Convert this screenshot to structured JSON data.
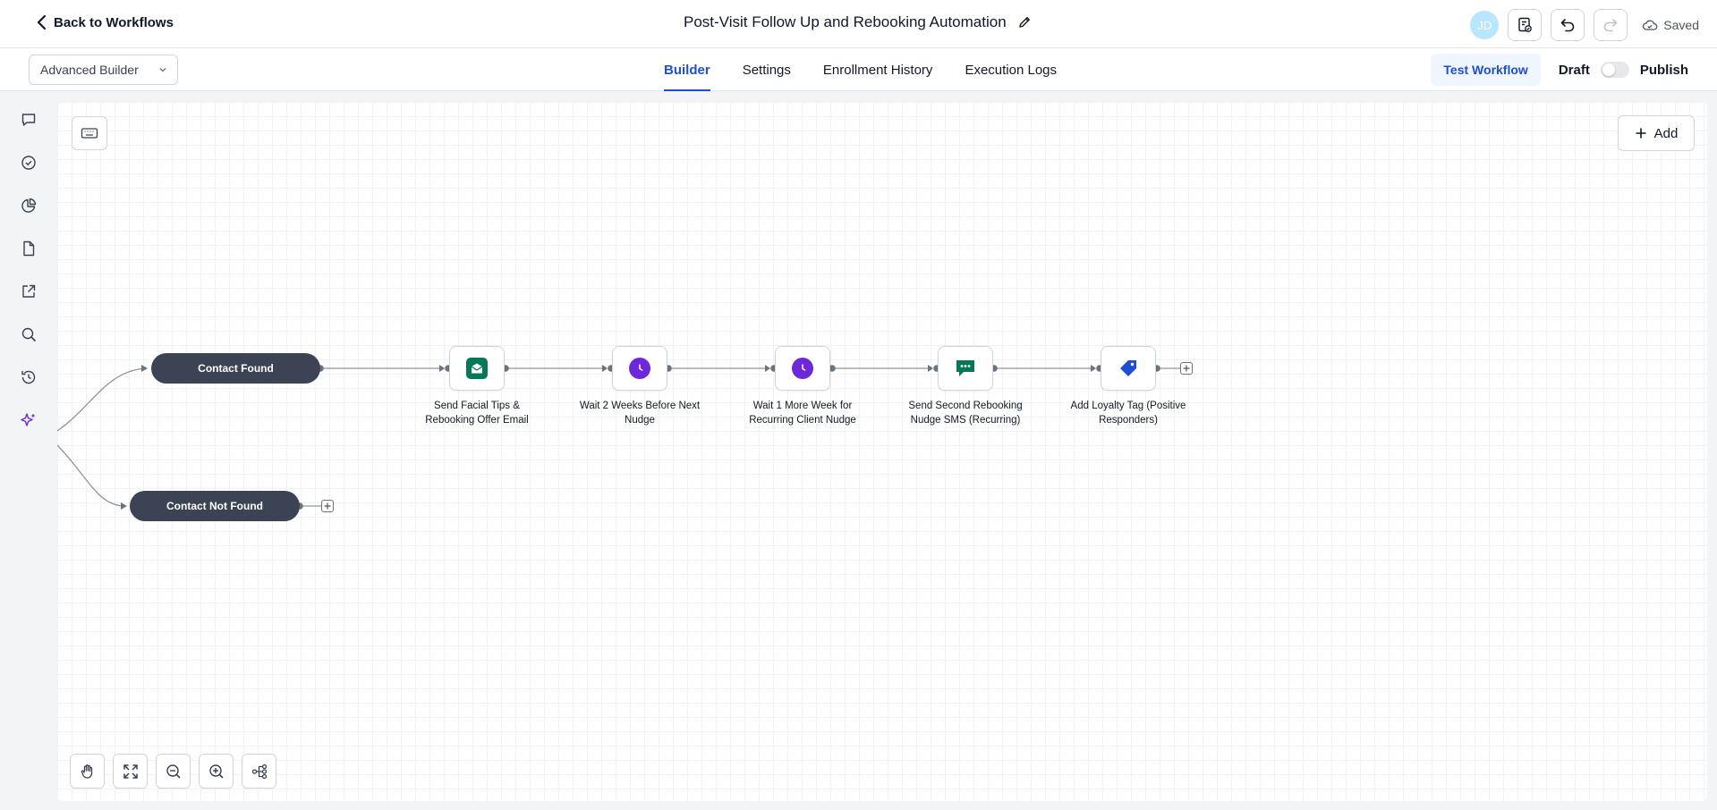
{
  "header": {
    "back_label": "Back to Workflows",
    "title": "Post-Visit Follow Up and Rebooking Automation",
    "avatar_initials": "JD",
    "saved_label": "Saved"
  },
  "subbar": {
    "builder_mode": "Advanced Builder",
    "tabs": [
      {
        "label": "Builder",
        "active": true
      },
      {
        "label": "Settings",
        "active": false
      },
      {
        "label": "Enrollment History",
        "active": false
      },
      {
        "label": "Execution Logs",
        "active": false
      }
    ],
    "test_label": "Test Workflow",
    "draft_label": "Draft",
    "publish_label": "Publish",
    "published": false
  },
  "sidebar": {
    "icons": [
      "chat-icon",
      "check-circle-icon",
      "pie-chart-icon",
      "file-icon",
      "external-link-icon",
      "search-icon",
      "history-icon",
      "sparkle-icon"
    ]
  },
  "canvas": {
    "add_label": "Add",
    "branches": [
      {
        "label": "Contact Found"
      },
      {
        "label": "Contact Not Found"
      }
    ],
    "steps": [
      {
        "label": "Send Facial Tips & Rebooking Offer Email",
        "icon": "email-icon",
        "color": "#047857"
      },
      {
        "label": "Wait 2 Weeks Before Next Nudge",
        "icon": "clock-icon",
        "color": "#6d28d9"
      },
      {
        "label": "Wait 1 More Week for Recurring Client Nudge",
        "icon": "clock-icon",
        "color": "#6d28d9"
      },
      {
        "label": "Send Second Rebooking Nudge SMS (Recurring)",
        "icon": "sms-icon",
        "color": "#047857"
      },
      {
        "label": "Add Loyalty Tag (Positive Responders)",
        "icon": "tag-icon",
        "color": "#1d4ed8"
      }
    ]
  },
  "colors": {
    "accent": "#1d4ed8",
    "pill": "#3c4354"
  }
}
